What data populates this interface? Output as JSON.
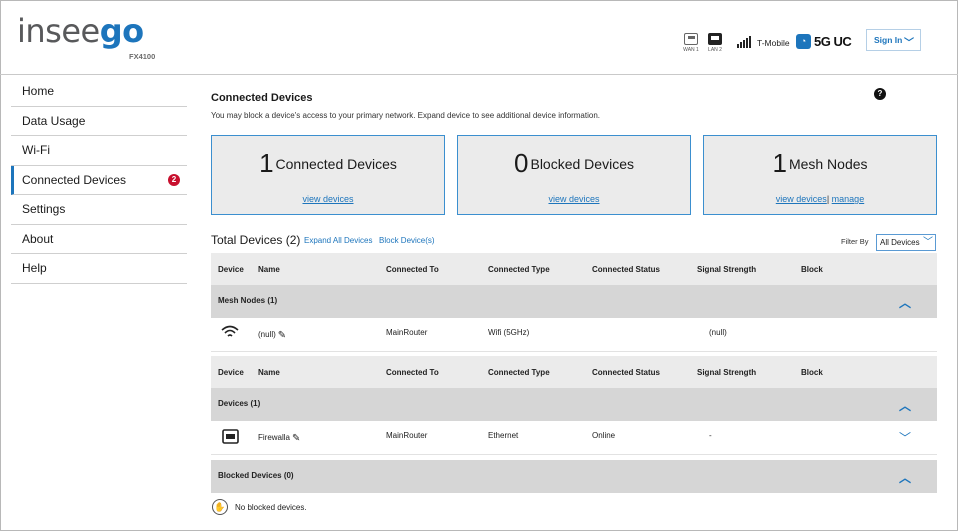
{
  "brand": {
    "logo_part1": "insee",
    "logo_part2": "go",
    "model": "FX4100"
  },
  "status": {
    "wan_label": "WAN 1",
    "lan_label": "LAN 2",
    "carrier": "T-Mobile",
    "network": "5G UC",
    "signin_label": "Sign In"
  },
  "sidebar": {
    "items": [
      {
        "label": "Home"
      },
      {
        "label": "Data Usage"
      },
      {
        "label": "Wi-Fi"
      },
      {
        "label": "Connected Devices",
        "badge": "2",
        "active": true
      },
      {
        "label": "Settings"
      },
      {
        "label": "About"
      },
      {
        "label": "Help"
      }
    ]
  },
  "page": {
    "title": "Connected Devices",
    "description": "You may block a device's access to your primary network. Expand device to see additional device information.",
    "help_glyph": "?"
  },
  "cards": {
    "connected": {
      "count": "1",
      "label": "Connected Devices",
      "link": "view devices"
    },
    "blocked": {
      "count": "0",
      "label": "Blocked Devices",
      "link": "view devices"
    },
    "mesh": {
      "count": "1",
      "label": "Mesh Nodes",
      "link": "view devices",
      "separator": "|",
      "link2": "manage"
    }
  },
  "list": {
    "title": "Total Devices (2)",
    "expand_all": "Expand All Devices",
    "block_devices": "Block Device(s)",
    "filter_label": "Filter By",
    "filter_value": "All Devices"
  },
  "columns": [
    "Device",
    "Name",
    "Connected To",
    "Connected Type",
    "Connected Status",
    "Signal Strength",
    "Block"
  ],
  "groups": {
    "mesh": {
      "title": "Mesh Nodes (1)",
      "row": {
        "name": "(null)",
        "connected_to": "MainRouter",
        "connected_type": "Wifi (5GHz)",
        "status": "",
        "signal": "(null)"
      }
    },
    "devices": {
      "title": "Devices (1)",
      "row": {
        "name": "Firewalla",
        "connected_to": "MainRouter",
        "connected_type": "Ethernet",
        "status": "Online",
        "signal": "-"
      }
    },
    "blocked": {
      "title": "Blocked Devices (0)",
      "empty": "No blocked devices."
    }
  },
  "colors": {
    "accent": "#1d75bc",
    "badge": "#c8102e",
    "header_row": "#ebebeb",
    "group_row": "#d6d6d6"
  }
}
